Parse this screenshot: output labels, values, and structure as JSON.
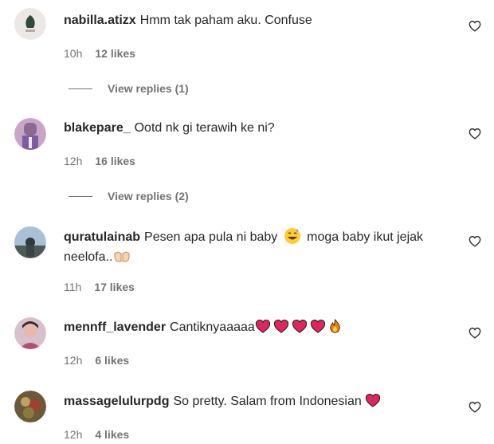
{
  "comments": [
    {
      "username": "nabilla.atizx",
      "text": "Hmm tak paham aku. Confuse",
      "time": "10h",
      "likes": "12 likes",
      "replies": "View replies (1)"
    },
    {
      "username": "blakepare_",
      "text": "Ootd nk gi terawih ke ni?",
      "time": "12h",
      "likes": "16 likes",
      "replies": "View replies (2)"
    },
    {
      "username": "quratulainab",
      "text_part1": "Pesen apa pula ni baby",
      "text_part2": "moga baby ikut jejak",
      "text_part3": "neelofa..",
      "time": "11h",
      "likes": "17 likes"
    },
    {
      "username": "mennff_lavender",
      "text": "Cantiknyaaaaa",
      "time": "12h",
      "likes": "6 likes"
    },
    {
      "username": "massagelulurpdg",
      "text": "So pretty. Salam from Indonesian",
      "time": "12h",
      "likes": "4 likes"
    }
  ],
  "icons": {
    "like": "heart-outline-icon",
    "heart_emoji": "red-heart-emoji",
    "fire_emoji": "fire-emoji",
    "sweat_emoji": "grinning-sweat-emoji",
    "hands_emoji": "open-hands-emoji"
  },
  "colors": {
    "text": "#262626",
    "secondary": "#737373",
    "heart": "#e0245e"
  }
}
